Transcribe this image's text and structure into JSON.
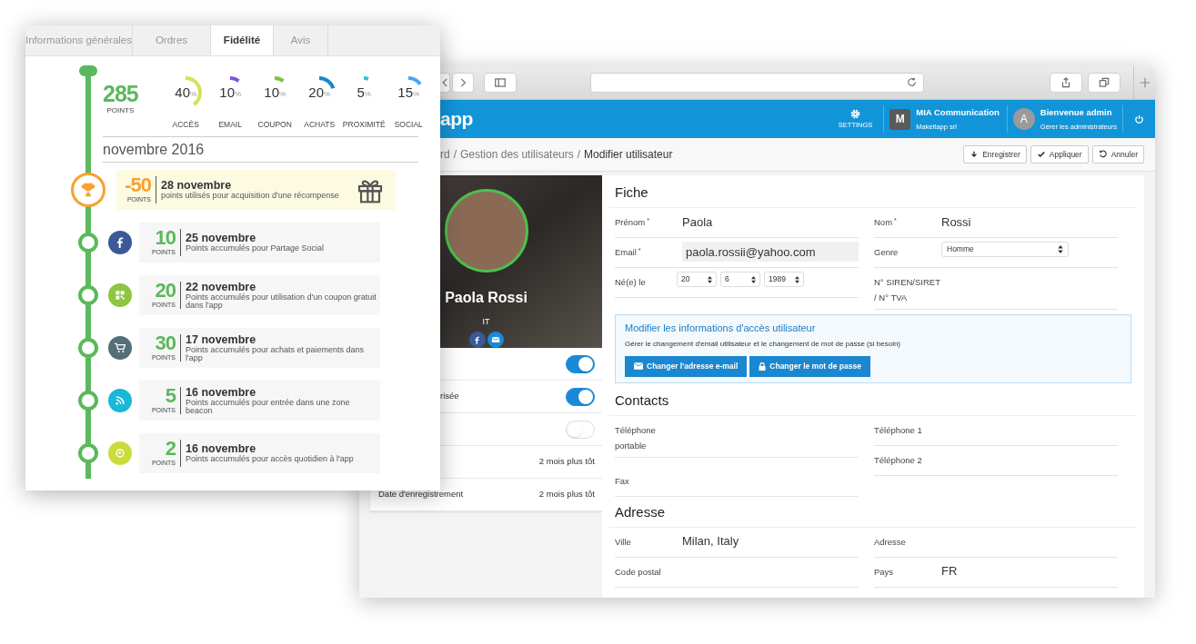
{
  "loyalty_card": {
    "tabs": [
      {
        "label": "Informations générales",
        "selected": false
      },
      {
        "label": "Ordres",
        "selected": false
      },
      {
        "label": "Fidélité",
        "selected": true
      },
      {
        "label": "Avis",
        "selected": false
      }
    ],
    "total": {
      "value": "285",
      "unit": "POINTS"
    },
    "gauges": [
      {
        "value": "40",
        "unit": "%",
        "label": "ACCÈS",
        "level": 0.4,
        "color": "#d4e157"
      },
      {
        "value": "10",
        "unit": "%",
        "label": "EMAIL",
        "level": 0.1,
        "color": "#7e4fe0"
      },
      {
        "value": "10",
        "unit": "%",
        "label": "COUPON",
        "level": 0.1,
        "color": "#7cc242"
      },
      {
        "value": "20",
        "unit": "%",
        "label": "ACHATS",
        "level": 0.2,
        "color": "#1a88c4"
      },
      {
        "value": "5",
        "unit": "%",
        "label": "PROXIMITÉ",
        "level": 0.05,
        "color": "#2ec4de"
      },
      {
        "value": "15",
        "unit": "%",
        "label": "SOCIAL",
        "level": 0.15,
        "color": "#4aa3f5"
      }
    ],
    "month": "novembre 2016",
    "entries": [
      {
        "kind": "reward",
        "color": "#f7a12f",
        "points": "-50",
        "unit": "POINTS",
        "date": "28 novembre",
        "description": "points utilisés pour acquisition d'une récompense"
      },
      {
        "kind": "social",
        "color": "#3b5998",
        "points": "10",
        "unit": "POINTS",
        "date": "25 novembre",
        "description": "Points accumulés pour Partage Social"
      },
      {
        "kind": "coupon",
        "color": "#8dc63f",
        "points": "20",
        "unit": "POINTS",
        "date": "22 novembre",
        "description": "Points accumulés pour utilisation d'un coupon gratuit dans l'app"
      },
      {
        "kind": "purchase",
        "color": "#546e7a",
        "points": "30",
        "unit": "POINTS",
        "date": "17 novembre",
        "description": "Points accumulés pour achats et paiements dans l'app"
      },
      {
        "kind": "beacon",
        "color": "#1ab7d6",
        "points": "5",
        "unit": "POINTS",
        "date": "16 novembre",
        "description": "Points accumulés pour entrée dans une zone beacon"
      },
      {
        "kind": "daily",
        "color": "#c9dc3c",
        "points": "2",
        "unit": "POINTS",
        "date": "16 novembre",
        "description": "Points accumulés pour accès quotidien à l'app"
      }
    ]
  },
  "browser": {
    "header": {
      "logo": "app",
      "settings": "SETTINGS",
      "company": {
        "initial": "M",
        "name": "MIA Communication",
        "subtitle": "Makeitapp srl"
      },
      "user": {
        "initial": "A",
        "greeting": "Bienvenue admin",
        "link": "Gérer les administrateurs"
      }
    },
    "breadcrumb": [
      "rd",
      "/",
      "Gestion des utilisateurs",
      "/",
      "Modifier utilisateur"
    ],
    "actions": [
      {
        "kind": "save",
        "label": "Enregistrer"
      },
      {
        "kind": "apply",
        "label": "Appliquer"
      },
      {
        "kind": "cancel",
        "label": "Annuler"
      }
    ],
    "profile": {
      "name": "Paola Rossi",
      "country": "IT",
      "rows": [
        {
          "kind": "toggle",
          "on": true
        },
        {
          "kind": "toggle",
          "label": "risée",
          "on": true
        },
        {
          "kind": "toggle",
          "on": false
        },
        {
          "kind": "info",
          "value": "2 mois plus tôt"
        },
        {
          "kind": "info",
          "label": "Date d'enregistrement",
          "value": "2 mois plus tôt"
        }
      ]
    },
    "form": {
      "sections": [
        {
          "title": "Fiche",
          "left": [
            {
              "kind": "text",
              "label": "Prénom",
              "mark": "*",
              "value": "Paola"
            },
            {
              "kind": "readonly",
              "label": "Email",
              "mark": "*",
              "value": "paola.rossii@yahoo.com"
            },
            {
              "kind": "date",
              "label": "Né(e) le",
              "parts": [
                "20",
                "6",
                "1989"
              ]
            }
          ],
          "right": [
            {
              "kind": "text",
              "label": "Nom",
              "mark": "*",
              "value": "Rossi"
            },
            {
              "kind": "select",
              "label": "Genre",
              "value": "Homme"
            },
            {
              "kind": "text",
              "label": "N° SIREN/SIRET / N° TVA"
            }
          ],
          "notice": {
            "title": "Modifier les informations d'accès utilisateur",
            "text": "Gérer le changement d'email utilisateur et le changement de mot de passe (si besoin)",
            "buttons": [
              {
                "kind": "email",
                "label": "Changer l'adresse e-mail"
              },
              {
                "kind": "password",
                "label": "Changer le mot de passe"
              }
            ]
          }
        },
        {
          "title": "Contacts",
          "left": [
            {
              "kind": "text",
              "label": "Téléphone portable"
            },
            {
              "kind": "text",
              "label": "Fax"
            }
          ],
          "right": [
            {
              "kind": "text",
              "label": "Téléphone 1"
            },
            {
              "kind": "text",
              "label": "Téléphone 2"
            }
          ]
        },
        {
          "title": "Adresse",
          "left": [
            {
              "kind": "text",
              "label": "Ville",
              "value": "Milan, Italy"
            },
            {
              "kind": "text",
              "label": "Code postal"
            }
          ],
          "right": [
            {
              "kind": "text",
              "label": "Adresse"
            },
            {
              "kind": "text",
              "label": "Pays",
              "value": "FR"
            }
          ]
        }
      ]
    }
  }
}
